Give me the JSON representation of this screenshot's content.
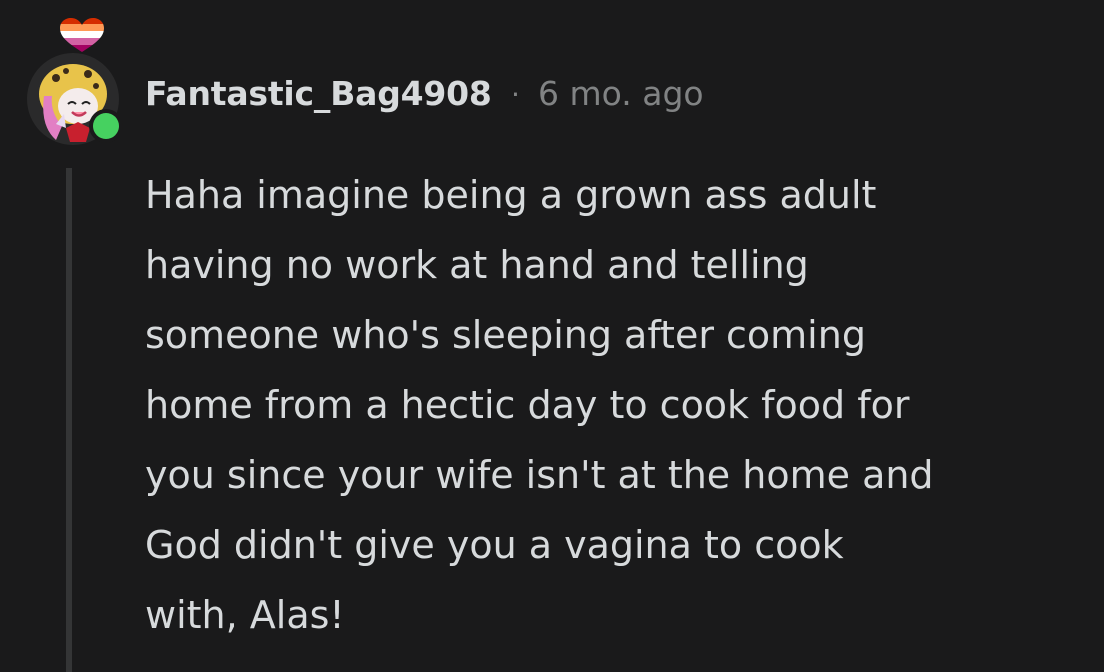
{
  "comment": {
    "username": "Fantastic_Bag4908",
    "separator": "·",
    "timestamp": "6 mo. ago",
    "body_lines": [
      "Haha imagine being a grown ass adult",
      "having no work at hand and telling",
      "someone who's sleeping after coming",
      "home from a hectic day to cook food for",
      "you since your wife isn't at the home and",
      "God didn't give you a vagina to cook",
      "with, Alas!"
    ],
    "flair_icon": "heart-flag-icon",
    "online_indicator": "online-status-icon",
    "colors": {
      "background": "#1a1a1b",
      "text": "#d7dadc",
      "muted": "#818384",
      "online": "#46d160",
      "thread_line": "#343536"
    }
  }
}
